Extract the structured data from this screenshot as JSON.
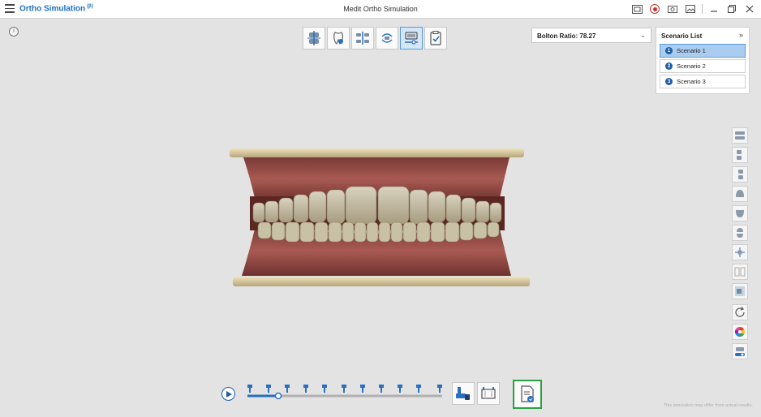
{
  "app": {
    "title": "Ortho Simulation",
    "badge": "(β)",
    "window_title": "Medit Ortho Simulation"
  },
  "toolbar": {
    "tools": [
      "arch-align-tool",
      "tooth-tool",
      "ipr-tool",
      "movement-tool",
      "stage-tool",
      "checklist-tool"
    ],
    "active": "stage-tool"
  },
  "bolton": {
    "label": "Bolton Ratio: 78.27"
  },
  "scenarios": {
    "title": "Scenario List",
    "items": [
      {
        "num": "1",
        "label": "Scenario 1",
        "selected": true
      },
      {
        "num": "2",
        "label": "Scenario 2",
        "selected": false
      },
      {
        "num": "3",
        "label": "Scenario 3",
        "selected": false
      }
    ]
  },
  "timeline": {
    "stages": 11,
    "current_stage": 1
  },
  "disclaimer": "This simulation may differ from actual results.",
  "colors": {
    "accent": "#1f6fc1",
    "selected": "#a9ccf0",
    "report_highlight": "#2aa044",
    "record": "#d32f2f"
  }
}
